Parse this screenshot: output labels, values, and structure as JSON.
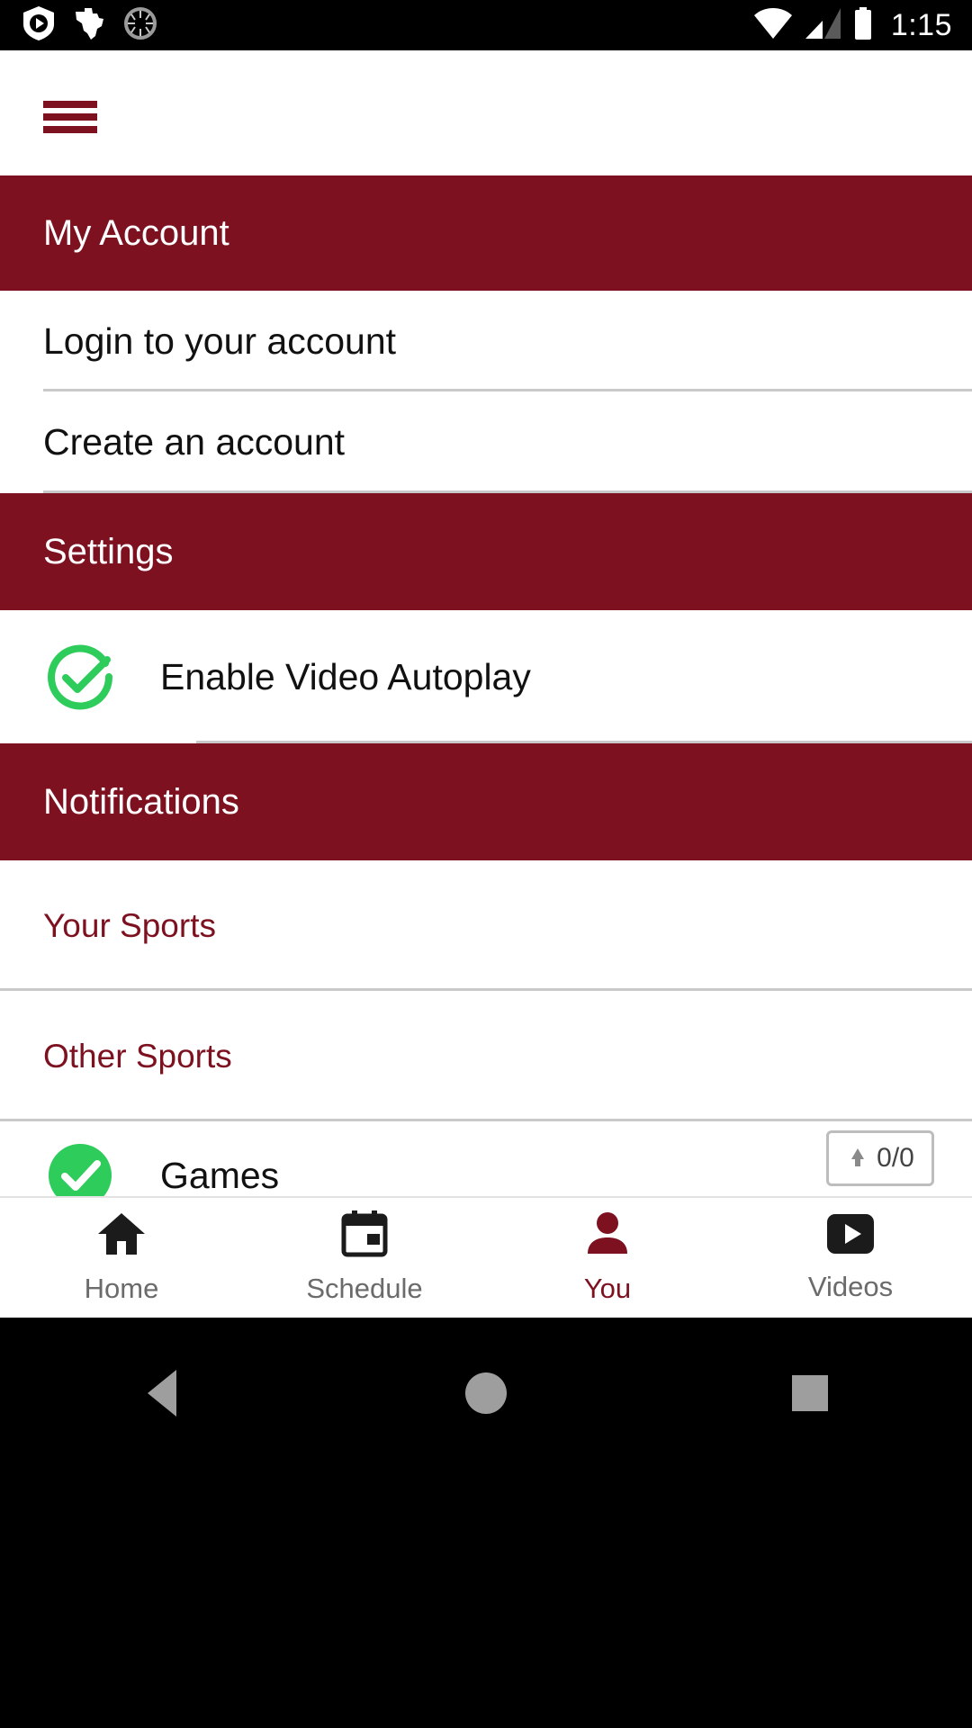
{
  "status_bar": {
    "icons_left": [
      "shield-play-icon",
      "texas-state-icon",
      "sync-spinner-icon"
    ],
    "icons_right": [
      "wifi-icon",
      "cell-signal-icon",
      "battery-icon"
    ],
    "clock": "1:15"
  },
  "toolbar": {
    "menu_icon": "hamburger-menu-icon"
  },
  "sections": {
    "my_account": {
      "title": "My Account",
      "items": [
        {
          "label": "Login to your account"
        },
        {
          "label": "Create an account"
        }
      ]
    },
    "settings": {
      "title": "Settings",
      "items": [
        {
          "label": "Enable Video Autoplay",
          "icon": "check-circle-icon",
          "checked": true
        }
      ]
    },
    "notifications": {
      "title": "Notifications",
      "items": [
        {
          "label": "Your Sports"
        },
        {
          "label": "Other Sports"
        },
        {
          "label": "Games",
          "icon": "check-circle-icon",
          "badge": "0/0"
        }
      ]
    }
  },
  "bottom_nav": {
    "items": [
      {
        "label": "Home",
        "icon": "home-icon",
        "active": false
      },
      {
        "label": "Schedule",
        "icon": "calendar-icon",
        "active": false
      },
      {
        "label": "You",
        "icon": "person-icon",
        "active": true
      },
      {
        "label": "Videos",
        "icon": "video-play-icon",
        "active": false
      }
    ]
  },
  "android_nav": {
    "back": "back-triangle-icon",
    "home": "home-circle-icon",
    "recents": "recents-square-icon"
  },
  "colors": {
    "brand_maroon": "#7D1120",
    "accent_green": "#2ECC5B",
    "divider": "#c9c9c9",
    "status_bar_bg": "#000000"
  }
}
